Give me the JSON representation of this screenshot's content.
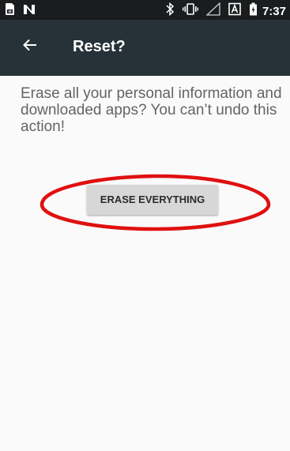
{
  "status_bar": {
    "time": "7:37",
    "icons": [
      "sim-card-icon",
      "n-notification-icon",
      "bluetooth-icon",
      "vibrate-icon",
      "signal-icon",
      "a-badge-icon",
      "battery-icon"
    ]
  },
  "toolbar": {
    "back_icon": "arrow-back-icon",
    "title": "Reset?"
  },
  "content": {
    "message": "Erase all your personal information and downloaded apps? You can’t undo this action!",
    "erase_button_label": "ERASE EVERYTHING"
  },
  "colors": {
    "status_bar_bg": "#1a1c1e",
    "toolbar_bg": "#263238",
    "page_bg": "#fafafa",
    "message_text": "#646464",
    "button_bg": "#d7d7d7",
    "annotation": "#e01010"
  }
}
